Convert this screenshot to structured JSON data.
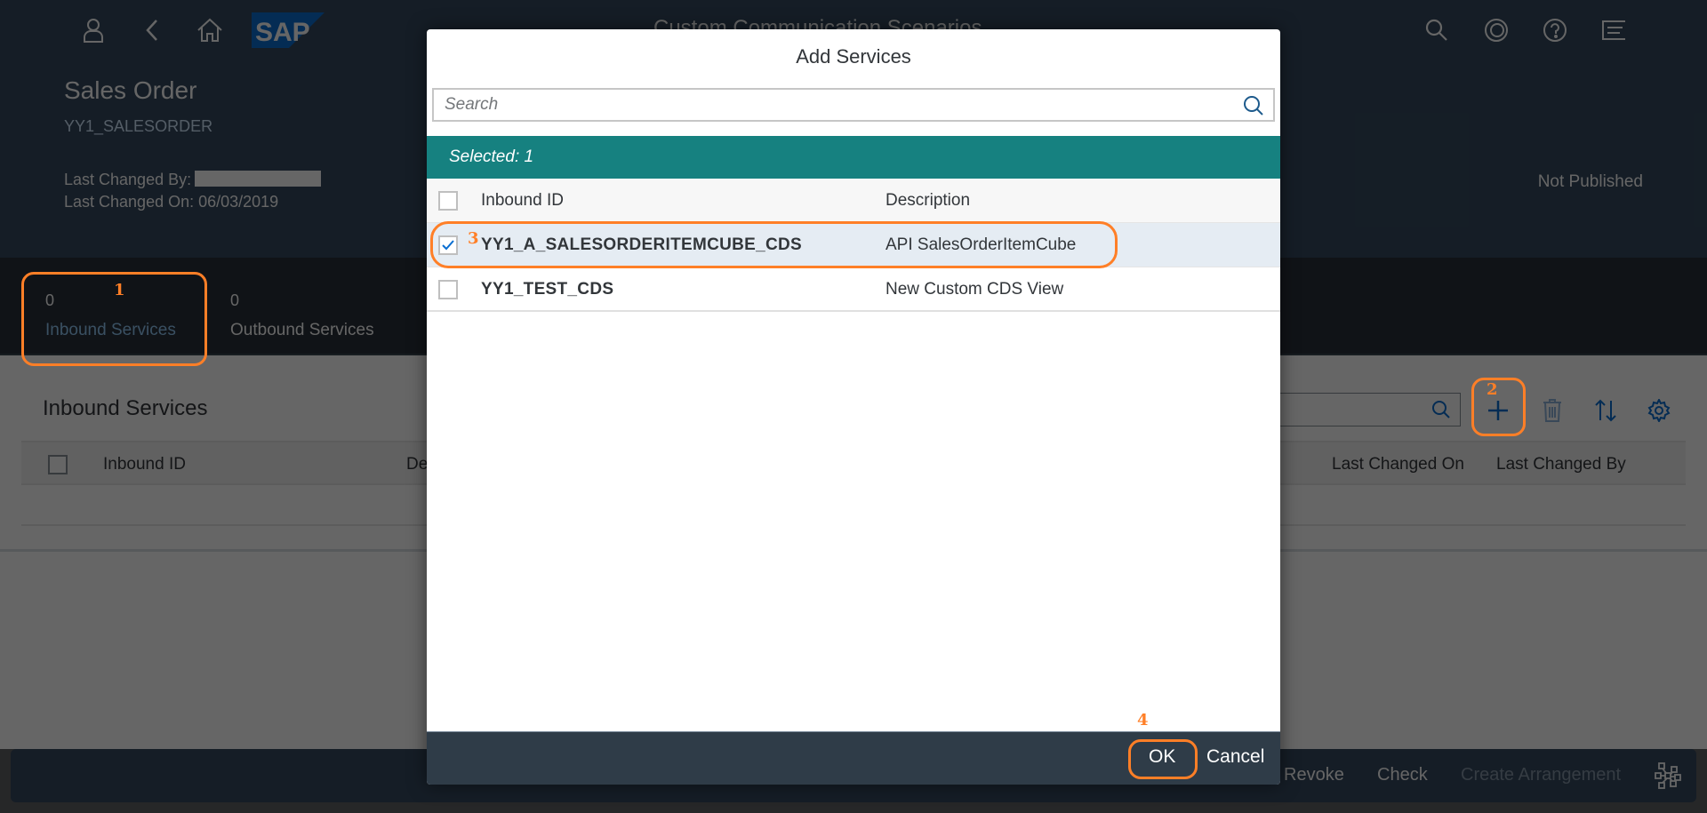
{
  "shell": {
    "title": "Custom Communication Scenarios",
    "icons": [
      "user-icon",
      "back-icon",
      "home-icon",
      "sap-logo",
      "search-icon",
      "copilot-icon",
      "help-icon",
      "notifications-icon"
    ],
    "logo_text": "SAP"
  },
  "object_header": {
    "title": "Sales Order",
    "id": "YY1_SALESORDER",
    "last_changed_by_label": "Last Changed By:",
    "last_changed_by_value": "",
    "last_changed_on_label": "Last Changed On: 06/03/2019",
    "status": "Not Published"
  },
  "tabs": [
    {
      "count": "0",
      "label": "Inbound Services",
      "selected": true
    },
    {
      "count": "0",
      "label": "Outbound Services",
      "selected": false
    }
  ],
  "section": {
    "title": "Inbound Services",
    "columns": [
      "Inbound ID",
      "De",
      "Last Changed On",
      "Last Changed By"
    ],
    "toolbar": [
      "add-icon",
      "delete-icon",
      "sort-icon",
      "settings-icon"
    ]
  },
  "page_footer": {
    "buttons": [
      {
        "label": "Revoke",
        "enabled": true
      },
      {
        "label": "Check",
        "enabled": true
      },
      {
        "label": "Create Arrangement",
        "enabled": false
      }
    ]
  },
  "dialog": {
    "title": "Add Services",
    "search_placeholder": "Search",
    "selected_text": "Selected: 1",
    "columns": [
      "Inbound ID",
      "Description"
    ],
    "rows": [
      {
        "id": "YY1_A_SALESORDERITEMCUBE_CDS",
        "description": "API SalesOrderItemCube",
        "checked": true
      },
      {
        "id": "YY1_TEST_CDS",
        "description": "New Custom CDS View",
        "checked": false
      }
    ],
    "ok_label": "OK",
    "cancel_label": "Cancel"
  },
  "annotations": [
    "1",
    "2",
    "3",
    "4"
  ],
  "colors": {
    "accent_teal": "#168180",
    "annotation_orange": "#ff7f27",
    "shell_bg": "#354a5f"
  }
}
